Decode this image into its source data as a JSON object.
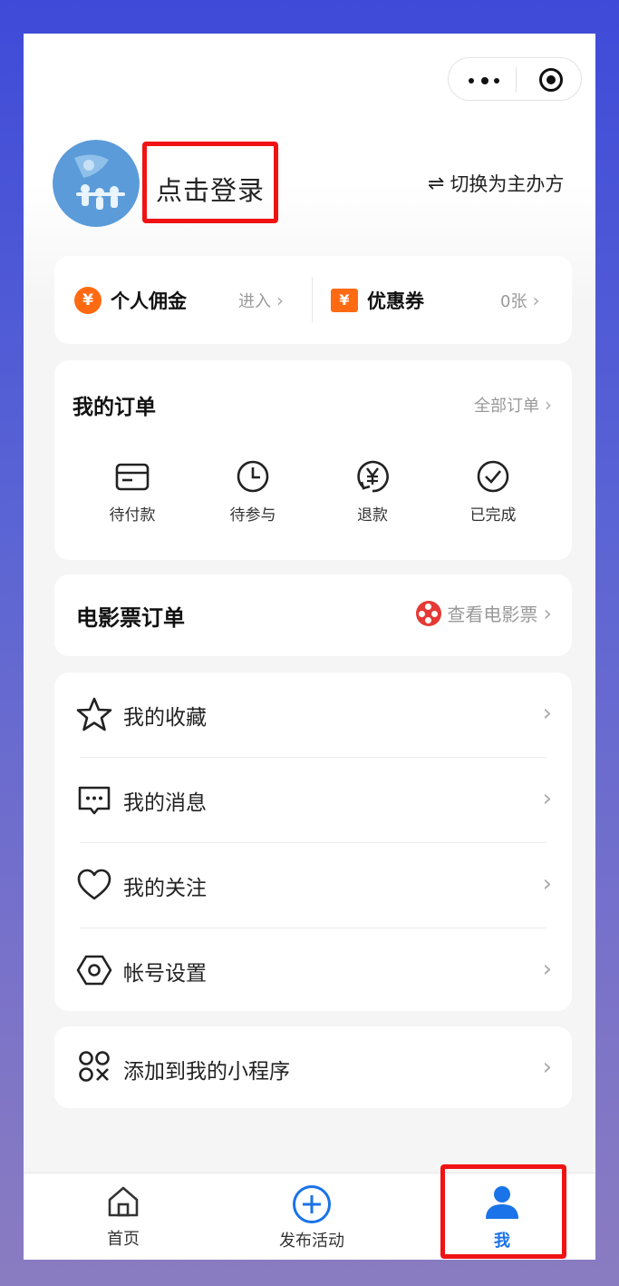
{
  "header": {
    "login_text": "点击登录",
    "switch_icon": "⇌",
    "switch_label": "切换为主办方"
  },
  "wallet": {
    "commission_icon": "¥",
    "commission_label": "个人佣金",
    "commission_link": "进入",
    "coupon_icon": "¥",
    "coupon_label": "优惠券",
    "coupon_count": "0张"
  },
  "orders": {
    "title": "我的订单",
    "all_link": "全部订单",
    "statuses": [
      {
        "label": "待付款",
        "icon": "card-icon"
      },
      {
        "label": "待参与",
        "icon": "clock-icon"
      },
      {
        "label": "退款",
        "icon": "refund-yen-icon"
      },
      {
        "label": "已完成",
        "icon": "check-circle-icon"
      }
    ]
  },
  "movie": {
    "title": "电影票订单",
    "link": "查看电影票"
  },
  "menu": [
    {
      "label": "我的收藏",
      "icon": "star-icon"
    },
    {
      "label": "我的消息",
      "icon": "message-icon"
    },
    {
      "label": "我的关注",
      "icon": "heart-icon"
    },
    {
      "label": "帐号设置",
      "icon": "settings-hex-icon"
    }
  ],
  "add_miniprogram": {
    "label": "添加到我的小程序",
    "icon": "miniprogram-icon"
  },
  "chevron": "›",
  "tabbar": {
    "home": "首页",
    "publish": "发布活动",
    "me": "我"
  },
  "colors": {
    "accent_orange": "#ff6a13",
    "tab_active": "#1a73e8",
    "highlight_red": "#f01313"
  }
}
